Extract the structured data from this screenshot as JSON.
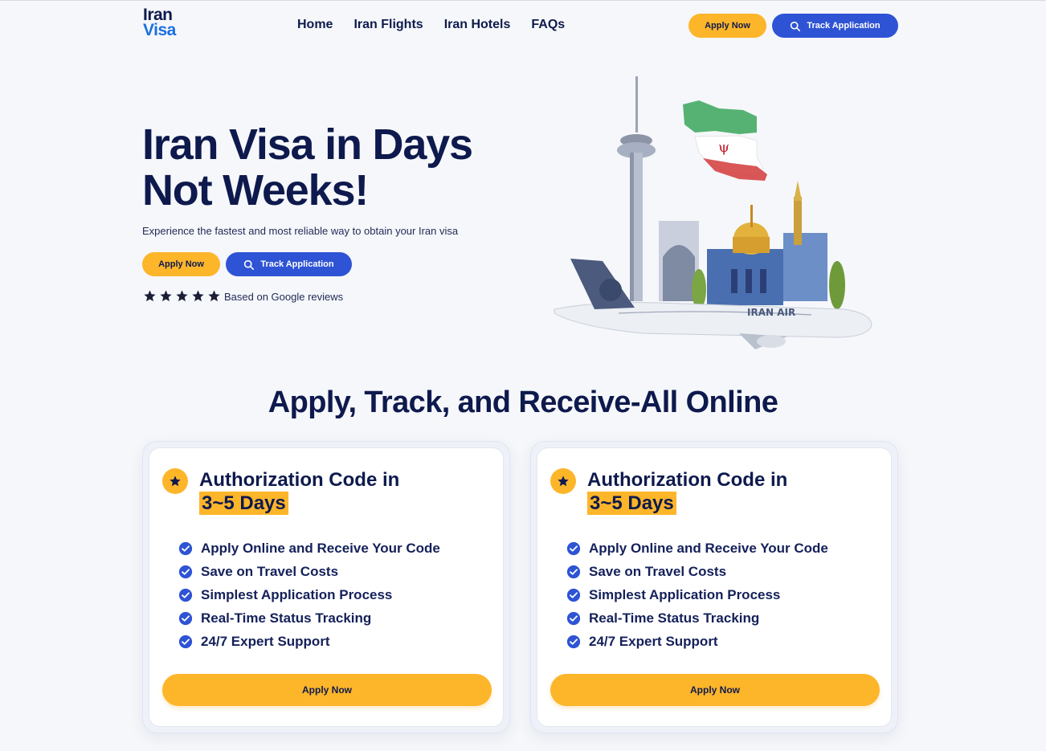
{
  "header": {
    "logo_line1": "Iran",
    "logo_line2": "Visa",
    "nav": [
      "Home",
      "Iran Flights",
      "Iran Hotels",
      "FAQs"
    ],
    "apply_label": "Apply Now",
    "track_label": "Track Application"
  },
  "hero": {
    "title_line1": "Iran Visa in Days",
    "title_line2": "Not Weeks!",
    "subtitle": "Experience the fastest and most reliable way to obtain your Iran visa",
    "apply_label": "Apply Now",
    "track_label": "Track Application",
    "rating_stars": 5,
    "reviews_text": "Based on Google reviews",
    "illustration_airline_text": "IRAN AIR"
  },
  "section": {
    "title": "Apply, Track, and Receive-All Online"
  },
  "cards": [
    {
      "title": "Authorization Code in",
      "highlight": "3~5 Days",
      "features": [
        "Apply Online and Receive Your Code",
        "Save on Travel Costs",
        "Simplest Application Process",
        "Real-Time Status Tracking",
        "24/7 Expert Support"
      ],
      "button_label": "Apply Now"
    },
    {
      "title": "Authorization Code in",
      "highlight": "3~5 Days",
      "features": [
        "Apply Online and Receive Your Code",
        "Save on Travel Costs",
        "Simplest Application Process",
        "Real-Time Status Tracking",
        "24/7 Expert Support"
      ],
      "button_label": "Apply Now"
    }
  ],
  "colors": {
    "navy": "#0e1a4d",
    "brand_blue": "#2e53d4",
    "logo_blue": "#1b6fe0",
    "accent_yellow": "#fdb52a",
    "background": "#f6f7fa"
  }
}
